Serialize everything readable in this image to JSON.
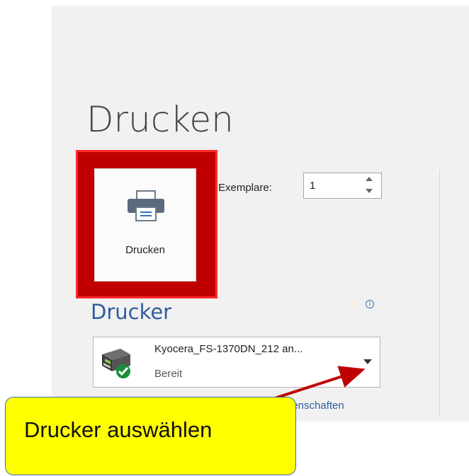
{
  "page": {
    "title": "Drucken"
  },
  "print_button": {
    "label": "Drucken",
    "icon": "printer-icon"
  },
  "copies": {
    "label": "Exemplare:",
    "value": "1"
  },
  "printer_section": {
    "heading": "Drucker",
    "info_icon": "info-icon",
    "selected_printer": {
      "name": "Kyocera_FS-1370DN_212 an...",
      "status": "Bereit",
      "icon": "printer-ready-icon"
    },
    "properties_link": "genschaften"
  },
  "callout": {
    "text": "Drucker auswählen"
  },
  "colors": {
    "highlight_red": "#c00000",
    "callout_yellow": "#ffff00",
    "accent_blue": "#2e5e9e",
    "arrow_red": "#c00000"
  }
}
